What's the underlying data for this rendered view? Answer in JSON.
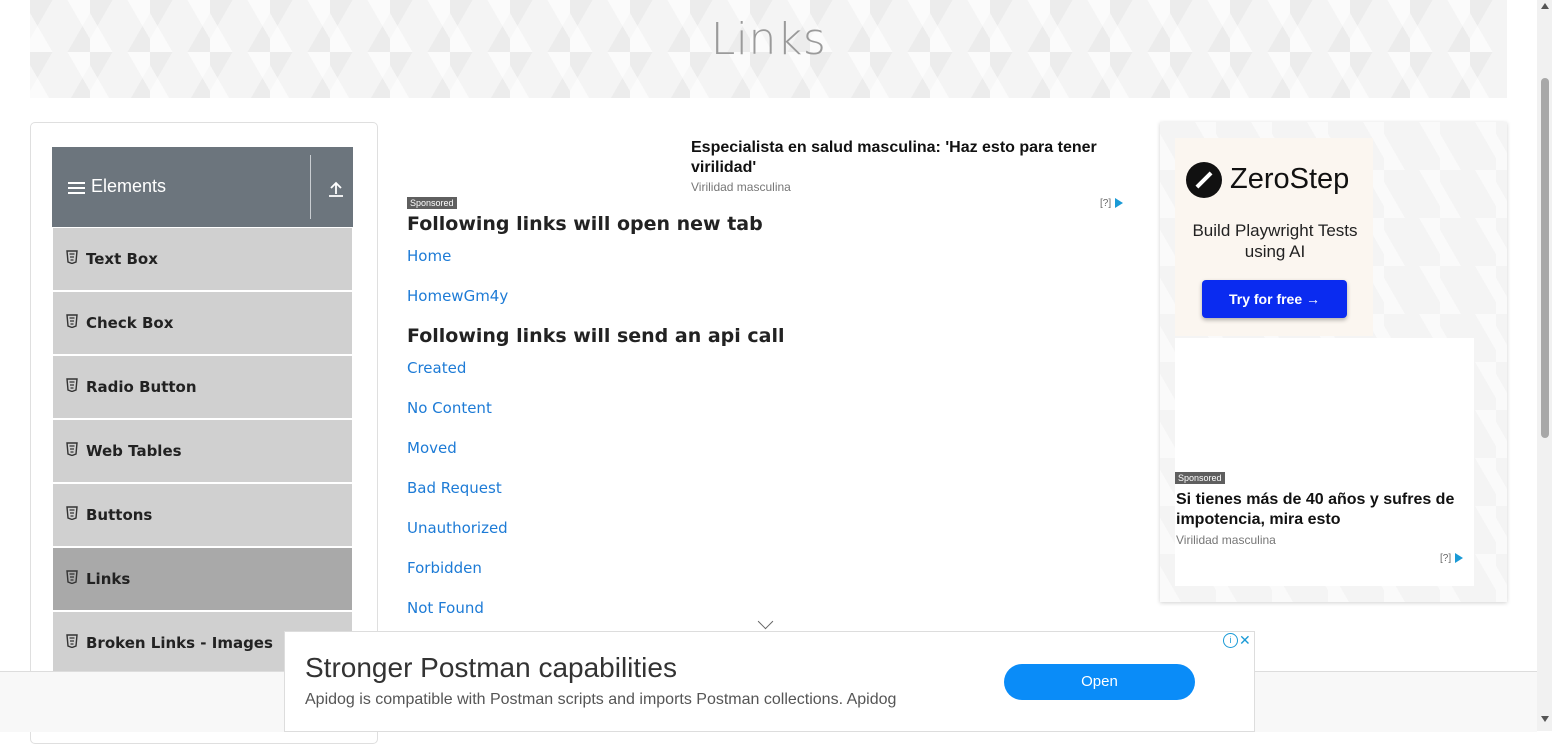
{
  "header": {
    "title": "Links"
  },
  "sidebar": {
    "group_label": "Elements",
    "items": [
      {
        "label": "Text Box"
      },
      {
        "label": "Check Box"
      },
      {
        "label": "Radio Button"
      },
      {
        "label": "Web Tables"
      },
      {
        "label": "Buttons"
      },
      {
        "label": "Links",
        "active": true
      },
      {
        "label": "Broken Links - Images"
      }
    ]
  },
  "top_ad": {
    "headline": "Especialista en salud masculina: 'Haz esto para tener virilidad'",
    "source": "Virilidad masculina",
    "sponsored": "Sponsored",
    "info": "[?]"
  },
  "main": {
    "new_tab_heading": "Following links will open new tab",
    "new_tab_links": [
      "Home",
      "HomewGm4y"
    ],
    "api_heading": "Following links will send an api call",
    "api_links": [
      "Created",
      "No Content",
      "Moved",
      "Bad Request",
      "Unauthorized",
      "Forbidden",
      "Not Found"
    ]
  },
  "right_ad": {
    "brand": "ZeroStep",
    "tagline": "Build Playwright Tests using AI",
    "cta": "Try for free →",
    "sponsored": "Sponsored",
    "headline": "Si tienes más de 40 años y sufres de impotencia, mira esto",
    "source": "Virilidad masculina",
    "info": "[?]"
  },
  "bottom_ad": {
    "headline": "Stronger Postman capabilities",
    "description": "Apidog is compatible with Postman scripts and imports Postman collections. Apidog",
    "button": "Open",
    "info_icon": "i",
    "close_icon": "✕"
  },
  "colors": {
    "link": "#1d7bd6",
    "sidebar_header": "#6c757d",
    "menu_item": "#d0d0d0",
    "menu_active": "#a9a9a9",
    "cta_blue": "#0a2bf0",
    "open_blue": "#0a8cf8"
  }
}
